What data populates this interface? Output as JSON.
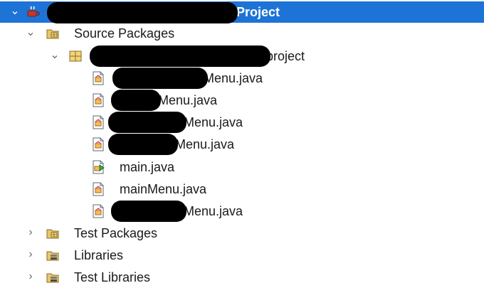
{
  "tree": {
    "project": {
      "label": "Project"
    },
    "source_packages": {
      "label": "Source Packages"
    },
    "package": {
      "label": "project"
    },
    "files": [
      {
        "label": "Menu.java"
      },
      {
        "label": "Menu.java"
      },
      {
        "label": "Menu.java"
      },
      {
        "label": "Menu.java"
      },
      {
        "label": "main.java"
      },
      {
        "label": "mainMenu.java"
      },
      {
        "label": "Menu.java"
      }
    ],
    "test_packages": {
      "label": "Test Packages"
    },
    "libraries": {
      "label": "Libraries"
    },
    "test_libraries": {
      "label": "Test Libraries"
    }
  },
  "colors": {
    "selection": "#1e73d6",
    "redaction": "#000000"
  }
}
